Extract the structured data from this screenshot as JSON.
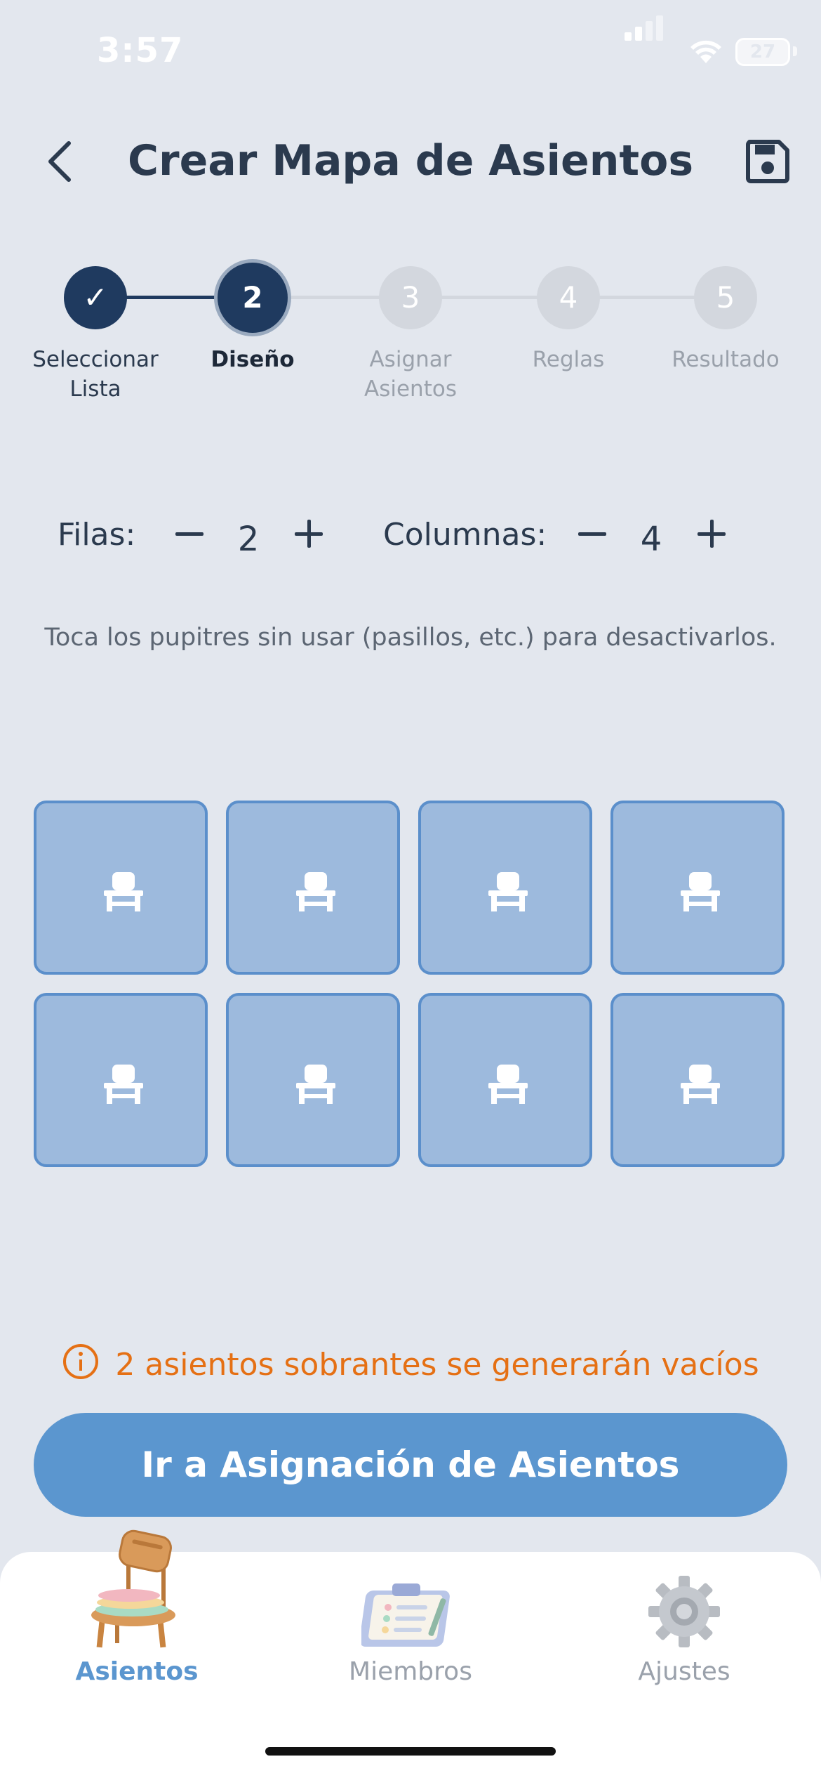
{
  "status_bar": {
    "time": "3:57",
    "battery": "27"
  },
  "header": {
    "title": "Crear Mapa de Asientos",
    "back_icon": "chevron-left-icon",
    "save_icon": "floppy-disk-icon"
  },
  "stepper": {
    "steps": [
      {
        "number": "✓",
        "label_line1": "Seleccionar",
        "label_line2": "Lista",
        "state": "done"
      },
      {
        "number": "2",
        "label_line1": "Diseño",
        "label_line2": "",
        "state": "active"
      },
      {
        "number": "3",
        "label_line1": "Asignar",
        "label_line2": "Asientos",
        "state": "pending"
      },
      {
        "number": "4",
        "label_line1": "Reglas",
        "label_line2": "",
        "state": "pending"
      },
      {
        "number": "5",
        "label_line1": "Resultado",
        "label_line2": "",
        "state": "pending"
      }
    ]
  },
  "controls": {
    "rows_label": "Filas:",
    "rows_value": "2",
    "columns_label": "Columnas:",
    "columns_value": "4"
  },
  "hint": "Toca los pupitres sin usar (pasillos, etc.) para desactivarlos.",
  "grid": {
    "rows": 2,
    "columns": 4,
    "seat_icon": "chair-icon"
  },
  "warning": {
    "icon": "info-icon",
    "text": "2 asientos sobrantes se generarán vacíos"
  },
  "primary_button": {
    "label": "Ir a Asignación de Asientos"
  },
  "tab_bar": {
    "tabs": [
      {
        "label": "Asientos",
        "icon": "chair-illustration-icon",
        "active": true
      },
      {
        "label": "Miembros",
        "icon": "clipboard-illustration-icon",
        "active": false
      },
      {
        "label": "Ajustes",
        "icon": "gear-illustration-icon",
        "active": false
      }
    ]
  },
  "colors": {
    "background": "#e3e7ee",
    "navy": "#1f3a5f",
    "accent": "#5b96cf",
    "seat_fill": "#9dbadd",
    "seat_border": "#5b8fcb",
    "warning": "#e57014"
  }
}
